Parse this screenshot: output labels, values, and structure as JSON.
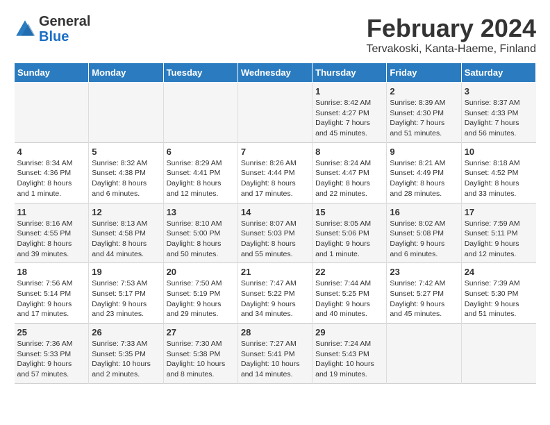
{
  "header": {
    "logo_line1": "General",
    "logo_line2": "Blue",
    "main_title": "February 2024",
    "subtitle": "Tervakoski, Kanta-Haeme, Finland"
  },
  "columns": [
    "Sunday",
    "Monday",
    "Tuesday",
    "Wednesday",
    "Thursday",
    "Friday",
    "Saturday"
  ],
  "weeks": [
    [
      {
        "day": "",
        "info": ""
      },
      {
        "day": "",
        "info": ""
      },
      {
        "day": "",
        "info": ""
      },
      {
        "day": "",
        "info": ""
      },
      {
        "day": "1",
        "info": "Sunrise: 8:42 AM\nSunset: 4:27 PM\nDaylight: 7 hours\nand 45 minutes."
      },
      {
        "day": "2",
        "info": "Sunrise: 8:39 AM\nSunset: 4:30 PM\nDaylight: 7 hours\nand 51 minutes."
      },
      {
        "day": "3",
        "info": "Sunrise: 8:37 AM\nSunset: 4:33 PM\nDaylight: 7 hours\nand 56 minutes."
      }
    ],
    [
      {
        "day": "4",
        "info": "Sunrise: 8:34 AM\nSunset: 4:36 PM\nDaylight: 8 hours\nand 1 minute."
      },
      {
        "day": "5",
        "info": "Sunrise: 8:32 AM\nSunset: 4:38 PM\nDaylight: 8 hours\nand 6 minutes."
      },
      {
        "day": "6",
        "info": "Sunrise: 8:29 AM\nSunset: 4:41 PM\nDaylight: 8 hours\nand 12 minutes."
      },
      {
        "day": "7",
        "info": "Sunrise: 8:26 AM\nSunset: 4:44 PM\nDaylight: 8 hours\nand 17 minutes."
      },
      {
        "day": "8",
        "info": "Sunrise: 8:24 AM\nSunset: 4:47 PM\nDaylight: 8 hours\nand 22 minutes."
      },
      {
        "day": "9",
        "info": "Sunrise: 8:21 AM\nSunset: 4:49 PM\nDaylight: 8 hours\nand 28 minutes."
      },
      {
        "day": "10",
        "info": "Sunrise: 8:18 AM\nSunset: 4:52 PM\nDaylight: 8 hours\nand 33 minutes."
      }
    ],
    [
      {
        "day": "11",
        "info": "Sunrise: 8:16 AM\nSunset: 4:55 PM\nDaylight: 8 hours\nand 39 minutes."
      },
      {
        "day": "12",
        "info": "Sunrise: 8:13 AM\nSunset: 4:58 PM\nDaylight: 8 hours\nand 44 minutes."
      },
      {
        "day": "13",
        "info": "Sunrise: 8:10 AM\nSunset: 5:00 PM\nDaylight: 8 hours\nand 50 minutes."
      },
      {
        "day": "14",
        "info": "Sunrise: 8:07 AM\nSunset: 5:03 PM\nDaylight: 8 hours\nand 55 minutes."
      },
      {
        "day": "15",
        "info": "Sunrise: 8:05 AM\nSunset: 5:06 PM\nDaylight: 9 hours\nand 1 minute."
      },
      {
        "day": "16",
        "info": "Sunrise: 8:02 AM\nSunset: 5:08 PM\nDaylight: 9 hours\nand 6 minutes."
      },
      {
        "day": "17",
        "info": "Sunrise: 7:59 AM\nSunset: 5:11 PM\nDaylight: 9 hours\nand 12 minutes."
      }
    ],
    [
      {
        "day": "18",
        "info": "Sunrise: 7:56 AM\nSunset: 5:14 PM\nDaylight: 9 hours\nand 17 minutes."
      },
      {
        "day": "19",
        "info": "Sunrise: 7:53 AM\nSunset: 5:17 PM\nDaylight: 9 hours\nand 23 minutes."
      },
      {
        "day": "20",
        "info": "Sunrise: 7:50 AM\nSunset: 5:19 PM\nDaylight: 9 hours\nand 29 minutes."
      },
      {
        "day": "21",
        "info": "Sunrise: 7:47 AM\nSunset: 5:22 PM\nDaylight: 9 hours\nand 34 minutes."
      },
      {
        "day": "22",
        "info": "Sunrise: 7:44 AM\nSunset: 5:25 PM\nDaylight: 9 hours\nand 40 minutes."
      },
      {
        "day": "23",
        "info": "Sunrise: 7:42 AM\nSunset: 5:27 PM\nDaylight: 9 hours\nand 45 minutes."
      },
      {
        "day": "24",
        "info": "Sunrise: 7:39 AM\nSunset: 5:30 PM\nDaylight: 9 hours\nand 51 minutes."
      }
    ],
    [
      {
        "day": "25",
        "info": "Sunrise: 7:36 AM\nSunset: 5:33 PM\nDaylight: 9 hours\nand 57 minutes."
      },
      {
        "day": "26",
        "info": "Sunrise: 7:33 AM\nSunset: 5:35 PM\nDaylight: 10 hours\nand 2 minutes."
      },
      {
        "day": "27",
        "info": "Sunrise: 7:30 AM\nSunset: 5:38 PM\nDaylight: 10 hours\nand 8 minutes."
      },
      {
        "day": "28",
        "info": "Sunrise: 7:27 AM\nSunset: 5:41 PM\nDaylight: 10 hours\nand 14 minutes."
      },
      {
        "day": "29",
        "info": "Sunrise: 7:24 AM\nSunset: 5:43 PM\nDaylight: 10 hours\nand 19 minutes."
      },
      {
        "day": "",
        "info": ""
      },
      {
        "day": "",
        "info": ""
      }
    ]
  ]
}
